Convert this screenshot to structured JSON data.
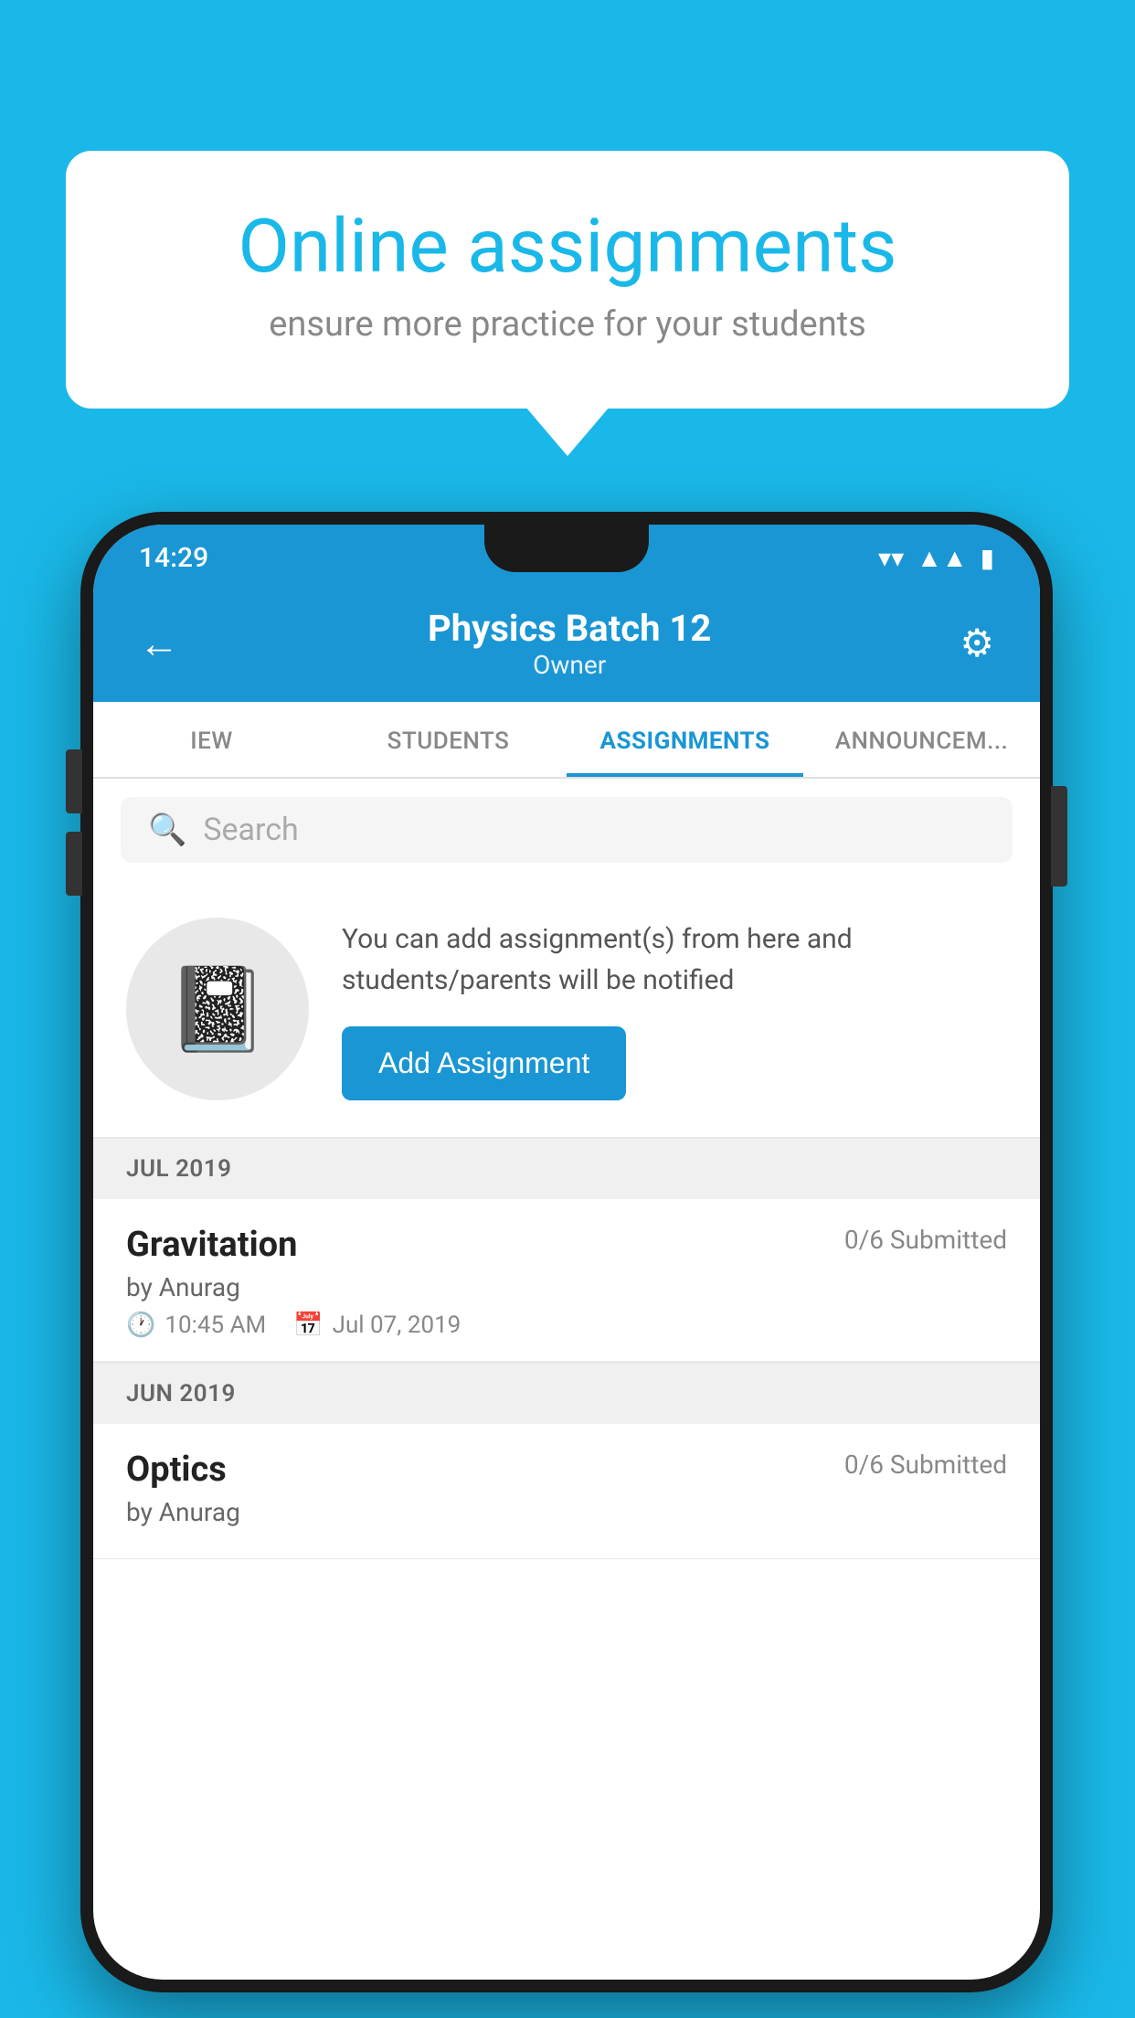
{
  "background_color": "#1ab8e8",
  "speech_bubble": {
    "title": "Online assignments",
    "subtitle": "ensure more practice for your students"
  },
  "phone": {
    "status_bar": {
      "time": "14:29",
      "wifi_icon": "▼",
      "signal_icon": "▲",
      "battery_icon": "▮"
    },
    "header": {
      "back_label": "←",
      "title": "Physics Batch 12",
      "subtitle": "Owner",
      "settings_label": "⚙"
    },
    "tabs": [
      {
        "label": "IEW",
        "active": false
      },
      {
        "label": "STUDENTS",
        "active": false
      },
      {
        "label": "ASSIGNMENTS",
        "active": true
      },
      {
        "label": "ANNOUNCEM...",
        "active": false
      }
    ],
    "search": {
      "placeholder": "Search"
    },
    "add_promo": {
      "description_text": "You can add assignment(s) from here and students/parents will be notified",
      "button_label": "Add Assignment"
    },
    "sections": [
      {
        "label": "JUL 2019",
        "items": [
          {
            "name": "Gravitation",
            "submitted": "0/6 Submitted",
            "by": "by Anurag",
            "time": "10:45 AM",
            "date": "Jul 07, 2019"
          }
        ]
      },
      {
        "label": "JUN 2019",
        "items": [
          {
            "name": "Optics",
            "submitted": "0/6 Submitted",
            "by": "by Anurag",
            "time": "",
            "date": ""
          }
        ]
      }
    ]
  }
}
